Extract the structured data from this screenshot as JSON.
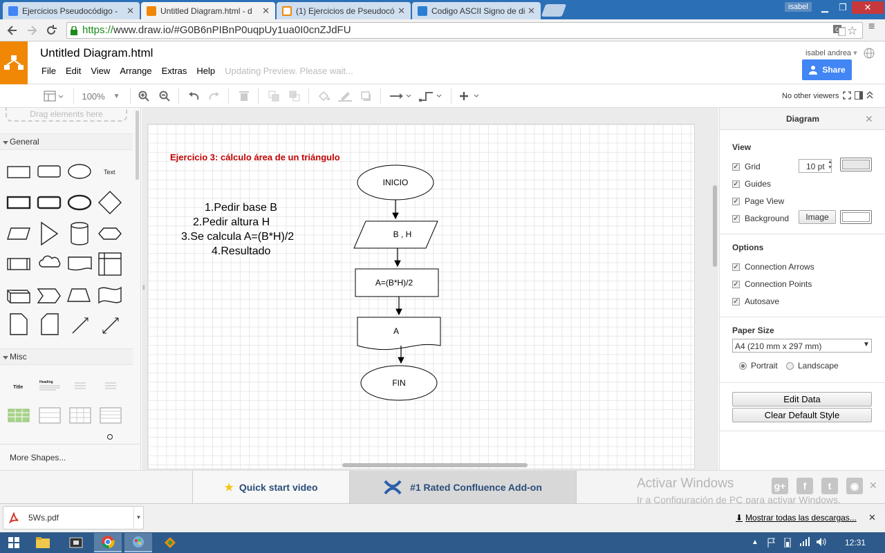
{
  "browser": {
    "tabs": [
      {
        "label": "Ejercicios Pseudocódigo - ",
        "icon": "google-docs-icon",
        "color": "#4285f4",
        "active": false
      },
      {
        "label": "Untitled Diagram.html - d",
        "icon": "drawio-icon",
        "color": "#f08705",
        "active": true
      },
      {
        "label": "(1) Ejercicios de Pseudocó",
        "icon": "blogger-icon",
        "color": "#e8e8e8",
        "active": false
      },
      {
        "label": "Codigo ASCII Signo de div",
        "icon": "play-icon",
        "color": "#2a7fd4",
        "active": false
      }
    ],
    "window_user": "isabel",
    "url_scheme": "https://",
    "url_rest": "www.draw.io/#G0B6nPIBnP0uqpUy1ua0I0cnZJdFU"
  },
  "app": {
    "title": "Untitled Diagram.html",
    "menus": [
      "File",
      "Edit",
      "View",
      "Arrange",
      "Extras",
      "Help"
    ],
    "status": "Updating Preview. Please wait...",
    "user_name": "isabel andrea",
    "share_label": "Share",
    "zoom": "100%",
    "viewers": "No other viewers"
  },
  "sidebar": {
    "drag_hint": "Drag elements here",
    "sections": [
      "General",
      "Misc"
    ],
    "text_shape_label": "Text",
    "misc_labels": [
      "Title",
      "Heading"
    ],
    "more_shapes": "More Shapes..."
  },
  "diagram": {
    "title": "Ejercicio 3: cálculo área de un triángulo",
    "steps": [
      "1.Pedir base B",
      "2.Pedir altura H",
      "3.Se calcula A=(B*H)/2",
      "4.Resultado"
    ],
    "nodes": {
      "start": "INICIO",
      "input": "B , H",
      "process": "A=(B*H)/2",
      "output": "A",
      "end": "FIN"
    }
  },
  "format_panel": {
    "header": "Diagram",
    "view_heading": "View",
    "grid_label": "Grid",
    "grid_size": "10 pt",
    "guides_label": "Guides",
    "page_view_label": "Page View",
    "background_label": "Background",
    "image_button": "Image",
    "options_heading": "Options",
    "options": [
      "Connection Arrows",
      "Connection Points",
      "Autosave"
    ],
    "paper_heading": "Paper Size",
    "paper_size": "A4 (210 mm x 297 mm)",
    "portrait": "Portrait",
    "landscape": "Landscape",
    "edit_data": "Edit Data",
    "clear_style": "Clear Default Style"
  },
  "promo": {
    "quick_start": "Quick start video",
    "confluence": "#1 Rated Confluence Add-on",
    "activate_title": "Activar Windows",
    "activate_sub": "Ir a Configuración de PC para activar Windows."
  },
  "downloads": {
    "file": "5Ws.pdf",
    "show_all": "Mostrar todas las descargas..."
  },
  "taskbar": {
    "clock": "12:31"
  },
  "colors": {
    "drawio_orange": "#f08705",
    "share_blue": "#4285f4",
    "title_red": "#c00000",
    "chrome_blue": "#2b6fb6",
    "taskbar": "#2d5a8a"
  }
}
